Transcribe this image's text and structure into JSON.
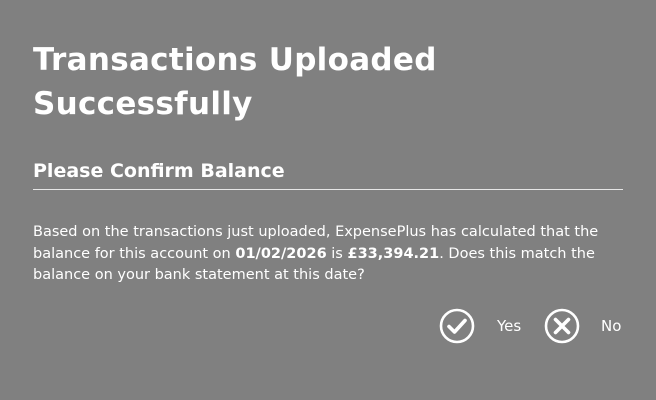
{
  "dialog": {
    "title": "Transactions Uploaded Successfully",
    "subtitle": "Please Confirm Balance",
    "message": {
      "part1": "Based on the transactions just uploaded, ExpensePlus has calculated that the balance for this account on ",
      "date": "01/02/2026",
      "part2": " is ",
      "amount": "£33,394.21",
      "part3": ". Does this match the balance on your bank statement at this date?"
    },
    "actions": {
      "yes_label": "Yes",
      "no_label": "No",
      "yes_icon": "check-circle-icon",
      "no_icon": "x-circle-icon"
    },
    "colors": {
      "background": "#808080",
      "text": "#ffffff"
    }
  }
}
